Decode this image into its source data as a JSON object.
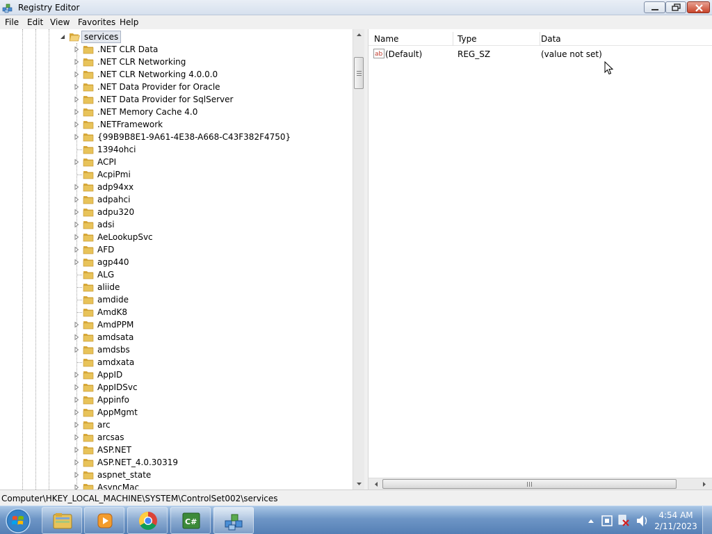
{
  "window": {
    "title": "Registry Editor"
  },
  "menu": [
    "File",
    "Edit",
    "View",
    "Favorites",
    "Help"
  ],
  "tree": {
    "selected": "services",
    "items": [
      {
        "label": ".NET CLR Data",
        "expandable": true
      },
      {
        "label": ".NET CLR Networking",
        "expandable": true
      },
      {
        "label": ".NET CLR Networking 4.0.0.0",
        "expandable": true
      },
      {
        "label": ".NET Data Provider for Oracle",
        "expandable": true
      },
      {
        "label": ".NET Data Provider for SqlServer",
        "expandable": true
      },
      {
        "label": ".NET Memory Cache 4.0",
        "expandable": true
      },
      {
        "label": ".NETFramework",
        "expandable": true
      },
      {
        "label": "{99B9B8E1-9A61-4E38-A668-C43F382F4750}",
        "expandable": true
      },
      {
        "label": "1394ohci",
        "expandable": false
      },
      {
        "label": "ACPI",
        "expandable": true
      },
      {
        "label": "AcpiPmi",
        "expandable": false
      },
      {
        "label": "adp94xx",
        "expandable": true
      },
      {
        "label": "adpahci",
        "expandable": true
      },
      {
        "label": "adpu320",
        "expandable": true
      },
      {
        "label": "adsi",
        "expandable": true
      },
      {
        "label": "AeLookupSvc",
        "expandable": true
      },
      {
        "label": "AFD",
        "expandable": true
      },
      {
        "label": "agp440",
        "expandable": true
      },
      {
        "label": "ALG",
        "expandable": false
      },
      {
        "label": "aliide",
        "expandable": false
      },
      {
        "label": "amdide",
        "expandable": false
      },
      {
        "label": "AmdK8",
        "expandable": false
      },
      {
        "label": "AmdPPM",
        "expandable": true
      },
      {
        "label": "amdsata",
        "expandable": true
      },
      {
        "label": "amdsbs",
        "expandable": true
      },
      {
        "label": "amdxata",
        "expandable": false
      },
      {
        "label": "AppID",
        "expandable": true
      },
      {
        "label": "AppIDSvc",
        "expandable": true
      },
      {
        "label": "Appinfo",
        "expandable": true
      },
      {
        "label": "AppMgmt",
        "expandable": true
      },
      {
        "label": "arc",
        "expandable": true
      },
      {
        "label": "arcsas",
        "expandable": true
      },
      {
        "label": "ASP.NET",
        "expandable": true
      },
      {
        "label": "ASP.NET_4.0.30319",
        "expandable": true
      },
      {
        "label": "aspnet_state",
        "expandable": true
      },
      {
        "label": "AsyncMac",
        "expandable": true
      }
    ]
  },
  "values": {
    "columns": [
      "Name",
      "Type",
      "Data"
    ],
    "rows": [
      {
        "name": "(Default)",
        "type": "REG_SZ",
        "data": "(value not set)"
      }
    ]
  },
  "status": {
    "path": "Computer\\HKEY_LOCAL_MACHINE\\SYSTEM\\ControlSet002\\services"
  },
  "taskbar": {
    "apps": [
      "Windows Explorer",
      "Windows Media Player",
      "Google Chrome",
      "C# Project",
      "Registry Editor"
    ],
    "active_app": "Registry Editor",
    "clock_time": "4:54 AM",
    "clock_date": "2/11/2023"
  },
  "colors": {
    "taskbar": "#6e96c6",
    "folder": "#e8c35a",
    "selection": "#e3e7ee"
  }
}
